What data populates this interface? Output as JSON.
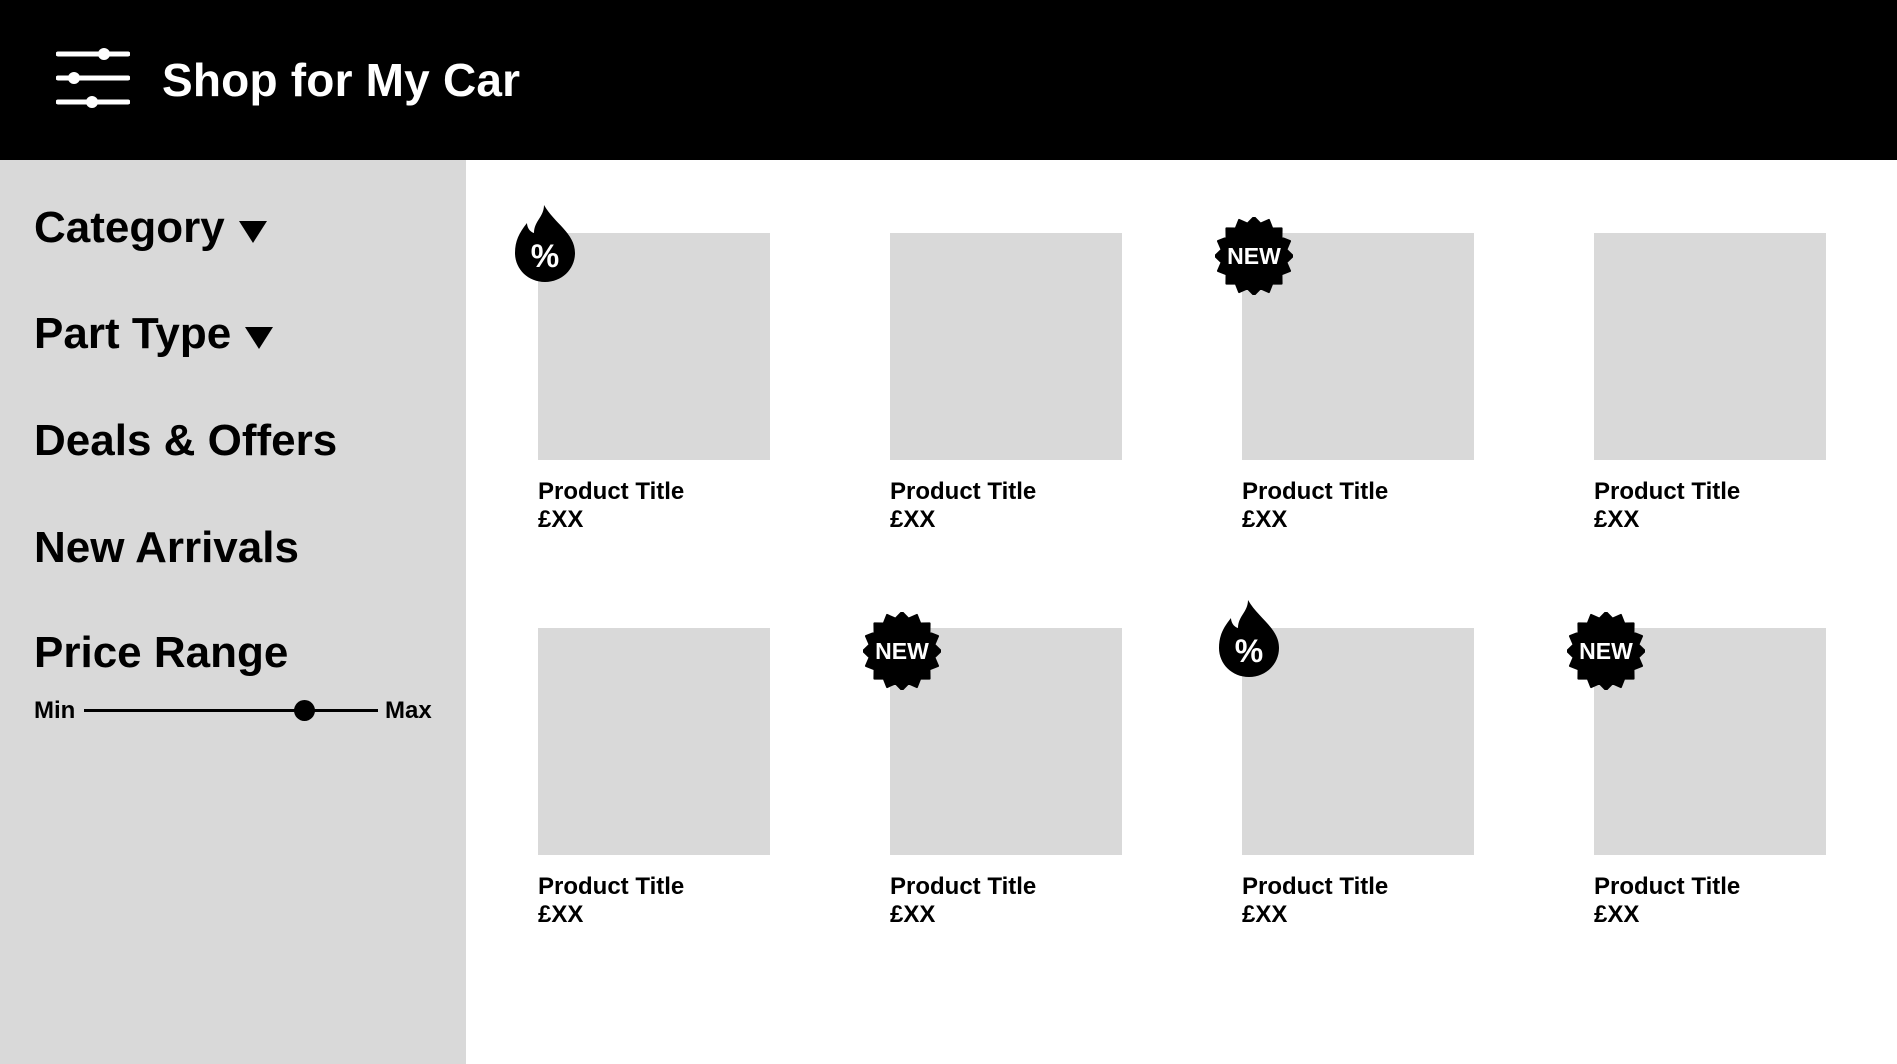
{
  "header": {
    "title": "Shop for My Car",
    "menu_icon": "filter-sliders-icon"
  },
  "sidebar": {
    "items": [
      {
        "label": "Category",
        "has_dropdown": true
      },
      {
        "label": "Part Type",
        "has_dropdown": true
      },
      {
        "label": "Deals & Offers",
        "has_dropdown": false
      },
      {
        "label": "New Arrivals",
        "has_dropdown": false
      }
    ],
    "price_range": {
      "label": "Price Range",
      "min_label": "Min",
      "max_label": "Max",
      "value_fraction": 0.75
    }
  },
  "products": [
    {
      "title": "Product Title",
      "price": "£XX",
      "badge": "sale"
    },
    {
      "title": "Product Title",
      "price": "£XX",
      "badge": null
    },
    {
      "title": "Product Title",
      "price": "£XX",
      "badge": "new"
    },
    {
      "title": "Product Title",
      "price": "£XX",
      "badge": null
    },
    {
      "title": "Product Title",
      "price": "£XX",
      "badge": null
    },
    {
      "title": "Product Title",
      "price": "£XX",
      "badge": "new"
    },
    {
      "title": "Product Title",
      "price": "£XX",
      "badge": "sale"
    },
    {
      "title": "Product Title",
      "price": "£XX",
      "badge": "new"
    }
  ],
  "badges": {
    "new_text": "NEW",
    "sale_text": "%"
  },
  "colors": {
    "header_bg": "#000000",
    "sidebar_bg": "#d9d9d9",
    "placeholder": "#d9d9d9"
  }
}
